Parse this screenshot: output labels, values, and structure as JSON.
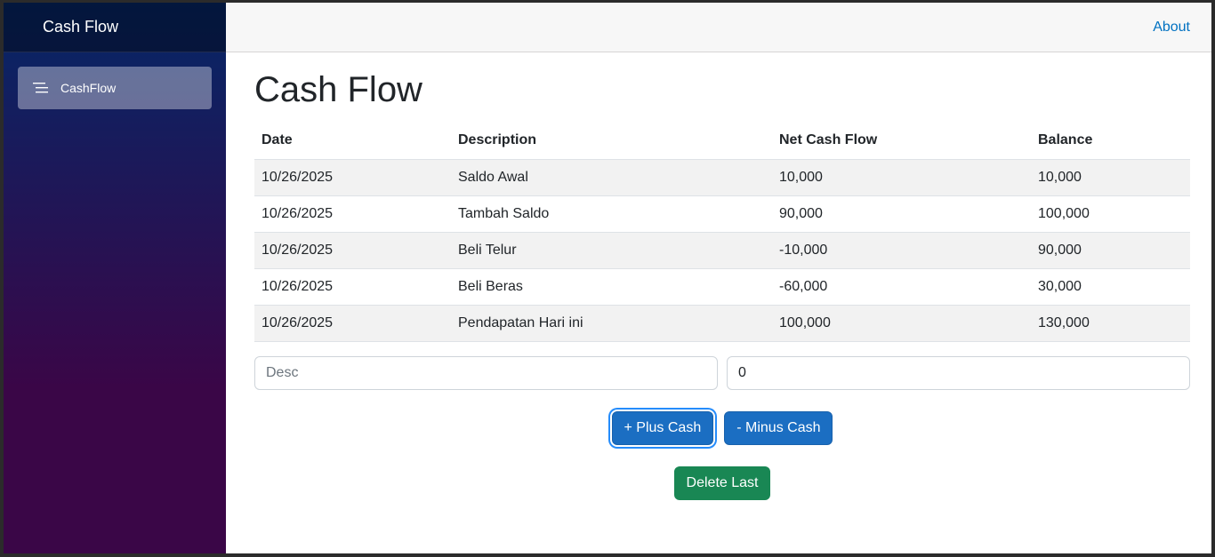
{
  "brand": {
    "title": "Cash Flow"
  },
  "nav": {
    "items": [
      {
        "label": "CashFlow",
        "icon": "list-icon"
      }
    ]
  },
  "top_row": {
    "about_label": "About"
  },
  "page": {
    "title": "Cash Flow"
  },
  "table": {
    "headers": [
      "Date",
      "Description",
      "Net Cash Flow",
      "Balance"
    ],
    "rows": [
      [
        "10/26/2025",
        "Saldo Awal",
        "10,000",
        "10,000"
      ],
      [
        "10/26/2025",
        "Tambah Saldo",
        "90,000",
        "100,000"
      ],
      [
        "10/26/2025",
        "Beli Telur",
        "-10,000",
        "90,000"
      ],
      [
        "10/26/2025",
        "Beli Beras",
        "-60,000",
        "30,000"
      ],
      [
        "10/26/2025",
        "Pendapatan Hari ini",
        "100,000",
        "130,000"
      ]
    ]
  },
  "form": {
    "desc_placeholder": "Desc",
    "desc_value": "",
    "amount_value": "0"
  },
  "buttons": {
    "plus_label": "+ Plus Cash",
    "minus_label": "- Minus Cash",
    "delete_label": "Delete Last"
  },
  "colors": {
    "primary": "#1b6ec2",
    "success": "#198754",
    "link": "#0071c1"
  }
}
